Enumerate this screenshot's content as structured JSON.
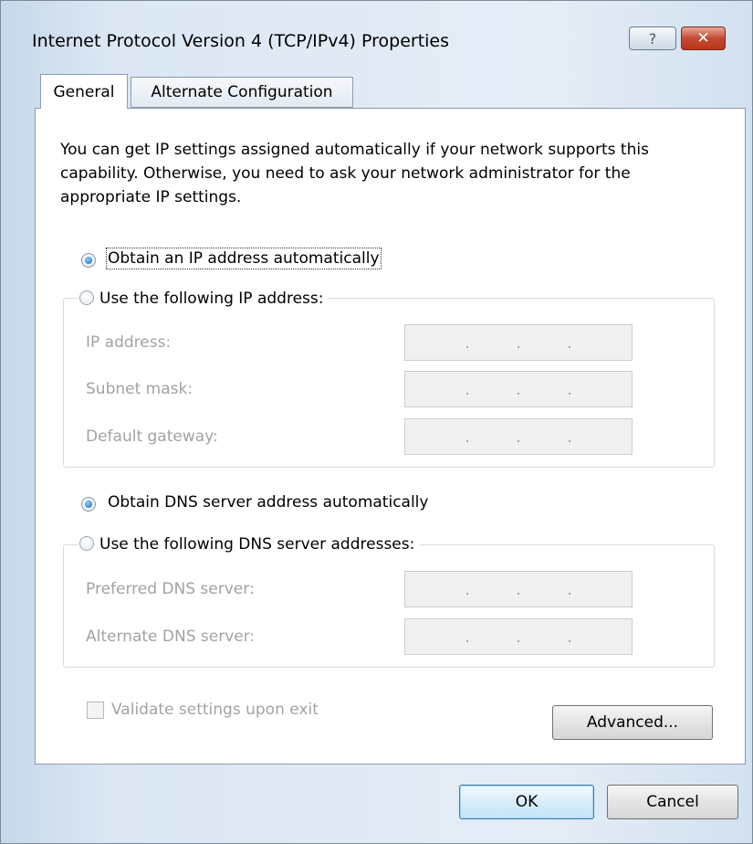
{
  "dialog": {
    "title": "Internet Protocol Version 4 (TCP/IPv4) Properties",
    "help_button": "?",
    "close_button": "✕"
  },
  "tabs": [
    {
      "label": "General",
      "selected": true
    },
    {
      "label": "Alternate Configuration",
      "selected": false
    }
  ],
  "intro_text": "You can get IP settings assigned automatically if your network supports this capability. Otherwise, you need to ask your network administrator for the appropriate IP settings.",
  "ip": {
    "auto_label": "Obtain an IP address automatically",
    "auto_selected": true,
    "manual_label": "Use the following IP address:",
    "fields": [
      {
        "label": "IP address:",
        "value": ".   .   ."
      },
      {
        "label": "Subnet mask:",
        "value": ".   .   ."
      },
      {
        "label": "Default gateway:",
        "value": ".   .   ."
      }
    ]
  },
  "dns": {
    "auto_label": "Obtain DNS server address automatically",
    "auto_selected": true,
    "manual_label": "Use the following DNS server addresses:",
    "fields": [
      {
        "label": "Preferred DNS server:",
        "value": ".   .   ."
      },
      {
        "label": "Alternate DNS server:",
        "value": ".   .   ."
      }
    ]
  },
  "validate_label": "Validate settings upon exit",
  "validate_checked": false,
  "buttons": {
    "advanced": "Advanced...",
    "ok": "OK",
    "cancel": "Cancel"
  },
  "colors": {
    "accent": "#1a5fb4",
    "close": "#c24a32"
  }
}
